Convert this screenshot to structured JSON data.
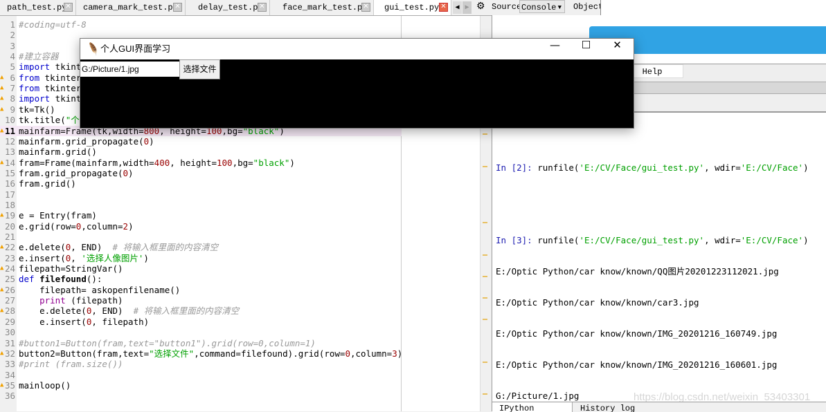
{
  "editor_tabs": [
    {
      "label": "path_test.py",
      "active": false
    },
    {
      "label": "camera_mark_test.py",
      "active": false
    },
    {
      "label": "delay_test.py",
      "active": false
    },
    {
      "label": "face_mark_test.py",
      "active": false
    },
    {
      "label": "gui_test.py",
      "active": true
    }
  ],
  "code_lines": [
    {
      "n": "1",
      "html": "<span class='cm'>#coding=utf-8</span>"
    },
    {
      "n": "2",
      "html": ""
    },
    {
      "n": "3",
      "html": ""
    },
    {
      "n": "4",
      "html": "<span class='cm'>#建立容器</span>"
    },
    {
      "n": "5",
      "html": "<span class='kw'>import</span> tkinte"
    },
    {
      "n": "6",
      "warn": true,
      "html": "<span class='kw'>from</span> tkinter"
    },
    {
      "n": "7",
      "warn": true,
      "html": "<span class='kw'>from</span> tkinter."
    },
    {
      "n": "8",
      "warn": true,
      "html": "<span class='kw'>import</span> tkinte"
    },
    {
      "n": "9",
      "warn": true,
      "html": "tk=Tk()"
    },
    {
      "n": "10",
      "html": "tk.title(<span class='st'>\"个人</span>"
    },
    {
      "n": "11",
      "warn": true,
      "cur": true,
      "html": "mainfarm=Frame(tk,width=<span class='nm'>800</span>, height=<span class='nm'>100</span>,bg=<span class='st'>\"black\"</span>)"
    },
    {
      "n": "12",
      "html": "mainfarm.grid_propagate(<span class='nm'>0</span>)"
    },
    {
      "n": "13",
      "html": "mainfarm.grid()"
    },
    {
      "n": "14",
      "warn": true,
      "html": "fram=Frame(mainfarm,width=<span class='nm'>400</span>, height=<span class='nm'>100</span>,bg=<span class='st'>\"black\"</span>)"
    },
    {
      "n": "15",
      "html": "fram.grid_propagate(<span class='nm'>0</span>)"
    },
    {
      "n": "16",
      "html": "fram.grid()"
    },
    {
      "n": "17",
      "html": ""
    },
    {
      "n": "18",
      "html": ""
    },
    {
      "n": "19",
      "warn": true,
      "html": "e = Entry(fram)"
    },
    {
      "n": "20",
      "html": "e.grid(row=<span class='nm'>0</span>,column=<span class='nm'>2</span>)"
    },
    {
      "n": "21",
      "html": ""
    },
    {
      "n": "22",
      "warn": true,
      "html": "e.delete(<span class='nm'>0</span>, END)  <span class='cm'># 将输入框里面的内容清空</span>"
    },
    {
      "n": "23",
      "html": "e.insert(<span class='nm'>0</span>, <span class='st'>'选择人像图片'</span>)"
    },
    {
      "n": "24",
      "warn": true,
      "html": "filepath=StringVar()"
    },
    {
      "n": "25",
      "html": "<span class='kw'>def</span> <b>filefound</b>():"
    },
    {
      "n": "26",
      "warn": true,
      "html": "    filepath= askopenfilename()"
    },
    {
      "n": "27",
      "html": "    <span class='bi'>print</span> (filepath)"
    },
    {
      "n": "28",
      "warn": true,
      "html": "    e.delete(<span class='nm'>0</span>, END)  <span class='cm'># 将输入框里面的内容清空</span>"
    },
    {
      "n": "29",
      "html": "    e.insert(<span class='nm'>0</span>, filepath)"
    },
    {
      "n": "30",
      "html": ""
    },
    {
      "n": "31",
      "html": "<span class='cm'>#button1=Button(fram,text=\"button1\").grid(row=0,column=1)</span>"
    },
    {
      "n": "32",
      "warn": true,
      "html": "button2=Button(fram,text=<span class='st'>\"选择文件\"</span>,command=filefound).grid(row=<span class='nm'>0</span>,column=<span class='nm'>3</span>)"
    },
    {
      "n": "33",
      "html": "<span class='cm'>#print (fram.size())</span>"
    },
    {
      "n": "34",
      "html": ""
    },
    {
      "n": "35",
      "warn": true,
      "html": "mainloop()"
    },
    {
      "n": "36",
      "html": ""
    }
  ],
  "right_toolbar": {
    "source": "Source",
    "console": "Console",
    "object": "Object"
  },
  "help_tab": {
    "partial": "er",
    "label": "Help"
  },
  "console": [
    {
      "prompt": "In [2]: ",
      "cmd": "runfile(",
      "s1": "'E:/CV/Face/gui_test.py'",
      "mid": ", wdir=",
      "s2": "'E:/CV/Face'",
      "end": ")"
    },
    {
      "prompt": "In [3]: ",
      "cmd": "runfile(",
      "s1": "'E:/CV/Face/gui_test.py'",
      "mid": ", wdir=",
      "s2": "'E:/CV/Face'",
      "end": ")"
    }
  ],
  "console_output": [
    "E:/Optic Python/car know/known/QQ图片20201223112021.jpg",
    "E:/Optic Python/car know/known/car3.jpg",
    "E:/Optic Python/car know/known/IMG_20201216_160749.jpg",
    "E:/Optic Python/car know/known/IMG_20201216_160601.jpg",
    "G:/Picture/1.jpg"
  ],
  "bottom_tabs": [
    "IPython console",
    "History log"
  ],
  "watermark": "https://blog.csdn.net/weixin_53403301",
  "dialog": {
    "title": "个人GUI界面学习",
    "entry_value": "G:/Picture/1.jpg",
    "button_label": "选择文件",
    "minimize": "—",
    "maximize": "☐",
    "close": "✕"
  },
  "colors": {
    "accent_blue": "#30a3e4",
    "keyword": "#0000cc",
    "string": "#00a000"
  }
}
